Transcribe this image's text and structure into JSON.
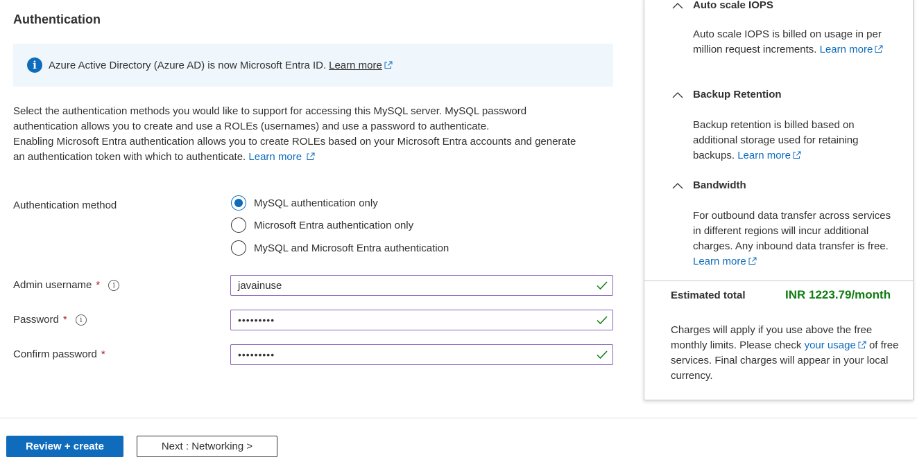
{
  "section": {
    "title": "Authentication"
  },
  "info": {
    "text": "Azure Active Directory (Azure AD) is now Microsoft Entra ID.",
    "link": "Learn more",
    "icon": "info-icon"
  },
  "description": {
    "line1": "Select the authentication methods you would like to support for accessing this MySQL server. MySQL password authentication allows you to create and use a ROLEs (usernames) and use a password to authenticate.",
    "line2": "Enabling Microsoft Entra authentication allows you to create ROLEs based on your Microsoft Entra accounts and generate an authentication token with which to authenticate.",
    "link": "Learn more"
  },
  "auth_method": {
    "label": "Authentication method",
    "options": [
      {
        "label": "MySQL authentication only",
        "checked": true
      },
      {
        "label": "Microsoft Entra authentication only",
        "checked": false
      },
      {
        "label": "MySQL and Microsoft Entra authentication",
        "checked": false
      }
    ]
  },
  "fields": {
    "admin_username": {
      "label": "Admin username",
      "required": "*",
      "value": "javainuse"
    },
    "password": {
      "label": "Password",
      "required": "*",
      "value": "•••••••••"
    },
    "confirm_password": {
      "label": "Confirm password",
      "required": "*",
      "value": "•••••••••"
    }
  },
  "footer": {
    "review_create": "Review + create",
    "next": "Next : Networking >"
  },
  "cost_panel": {
    "auto_scale": {
      "title": "Auto scale IOPS",
      "text": "Auto scale IOPS is billed on usage in per million request increments.",
      "link": "Learn more"
    },
    "backup": {
      "title": "Backup Retention",
      "text": "Backup retention is billed based on additional storage used for retaining backups.",
      "link": "Learn more"
    },
    "bandwidth": {
      "title": "Bandwidth",
      "text": "For outbound data transfer across services in different regions will incur additional charges. Any inbound data transfer is free.",
      "link": "Learn more"
    },
    "estimated_label": "Estimated total",
    "estimated_value": "INR 1223.79/month",
    "charges_pre": "Charges will apply if you use above the free monthly limits. Please check",
    "charges_link": "your usage",
    "charges_post": "of free services. Final charges will appear in your local currency."
  },
  "colors": {
    "accent": "#0f6cbd",
    "info_bg": "#eff6fc",
    "input_border": "#8764b8",
    "success": "#107c10",
    "required": "#a4262c"
  }
}
